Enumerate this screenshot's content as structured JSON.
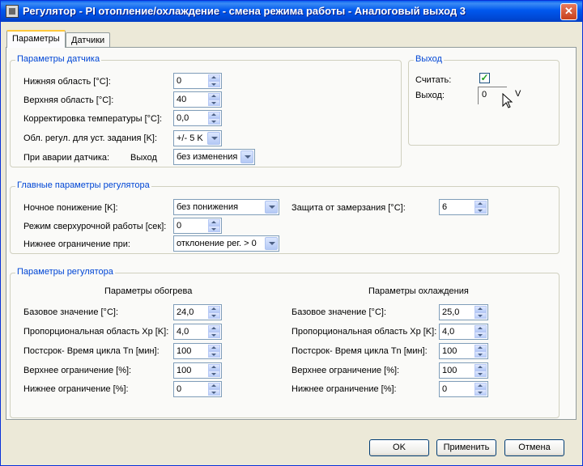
{
  "window": {
    "title": "Регулятор - PI отопление/охлаждение - смена режима работы - Аналоговый выход 3",
    "close_glyph": "✕"
  },
  "tabs": [
    {
      "label": "Параметры"
    },
    {
      "label": "Датчики"
    }
  ],
  "sensor_params": {
    "title": "Параметры датчика",
    "lower_label": "Нижняя область [°C]:",
    "lower_value": "0",
    "upper_label": "Верхняя область [°C]:",
    "upper_value": "40",
    "correction_label": "Корректировка температуры [°C]:",
    "correction_value": "0,0",
    "range_label": "Обл. регул. для уст. задания [K]:",
    "range_value": "+/- 5 K",
    "fault_label": "При аварии датчика:",
    "fault_sub_label": "Выход",
    "fault_value": "без изменения"
  },
  "output": {
    "title": "Выход",
    "read_label": "Считать:",
    "read_checked": true,
    "check_glyph": "✓",
    "output_label": "Выход:",
    "output_value": "0",
    "unit": "V"
  },
  "main_params": {
    "title": "Главные параметры регулятора",
    "night_label": "Ночное понижение  [K]:",
    "night_value": "без понижения",
    "overtime_label": "Режим сверхурочной работы [сек]:",
    "overtime_value": "0",
    "lower_limit_label": "Нижнее ограничение  при:",
    "lower_limit_value": "отклонение рег. > 0",
    "frost_label": "Защита от замерзания [°C]:",
    "frost_value": "6"
  },
  "controller_params": {
    "title": "Параметры регулятора",
    "heating": {
      "header": "Параметры обогрева",
      "base_label": "Базовое значение [°C]:",
      "base_value": "24,0",
      "prop_label": "Пропорциональная область Xp [K]:",
      "prop_value": "4,0",
      "tn_label": "Постсрок- Время цикла Tn  [мин]:",
      "tn_value": "100",
      "upper_label": "Верхнее ограничение [%]:",
      "upper_value": "100",
      "lower_label": "Нижнее ограничение [%]:",
      "lower_value": "0"
    },
    "cooling": {
      "header": "Параметры охлаждения",
      "base_label": "Базовое значение [°C]:",
      "base_value": "25,0",
      "prop_label": "Пропорциональная область Xp [K]:",
      "prop_value": "4,0",
      "tn_label": "Постсрок- Время цикла Tn  [мин]:",
      "tn_value": "100",
      "upper_label": "Верхнее ограничение [%]:",
      "upper_value": "100",
      "lower_label": "Нижнее ограничение [%]:",
      "lower_value": "0"
    }
  },
  "buttons": {
    "ok": "OK",
    "apply": "Применить",
    "cancel": "Отмена"
  },
  "colors": {
    "title_bar": "#0058ee",
    "group_title": "#0046d5",
    "checkbox_mark": "#21a121"
  }
}
